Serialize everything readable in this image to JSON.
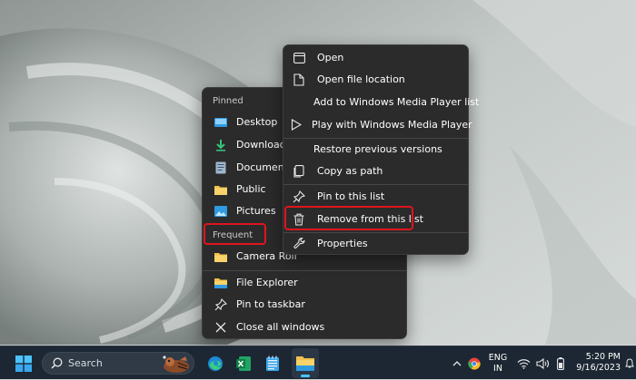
{
  "jumplist": {
    "pinned_header": "Pinned",
    "pinned_items": [
      {
        "label": "Desktop",
        "icon": "desktop-folder-icon"
      },
      {
        "label": "Downloads",
        "icon": "downloads-folder-icon"
      },
      {
        "label": "Documents",
        "icon": "documents-folder-icon"
      },
      {
        "label": "Public",
        "icon": "folder-icon"
      },
      {
        "label": "Pictures",
        "icon": "pictures-folder-icon"
      }
    ],
    "frequent_header": "Frequent",
    "frequent_items": [
      {
        "label": "Camera Roll",
        "icon": "folder-icon"
      }
    ],
    "actions": [
      {
        "label": "File Explorer",
        "icon": "file-explorer-icon"
      },
      {
        "label": "Pin to taskbar",
        "icon": "pin-icon"
      },
      {
        "label": "Close all windows",
        "icon": "close-icon"
      }
    ]
  },
  "context_menu": {
    "items": [
      {
        "label": "Open",
        "icon": "window-icon"
      },
      {
        "label": "Open file location",
        "icon": "file-location-icon"
      },
      {
        "label": "Add to Windows Media Player list",
        "icon": ""
      },
      {
        "label": "Play with Windows Media Player",
        "icon": "play-icon"
      },
      {
        "label": "Restore previous versions",
        "icon": ""
      },
      {
        "label": "Copy as path",
        "icon": "copy-path-icon"
      },
      {
        "label": "Pin to this list",
        "icon": "pin-icon"
      },
      {
        "label": "Remove from this list",
        "icon": "trash-icon"
      },
      {
        "label": "Properties",
        "icon": "wrench-icon"
      }
    ]
  },
  "taskbar": {
    "search_placeholder": "Search",
    "language_line1": "ENG",
    "language_line2": "IN",
    "time": "5:20 PM",
    "date": "9/16/2023"
  },
  "colors": {
    "highlight": "#e0141e",
    "menu_bg": "#2b2b2b",
    "taskbar_bg": "#1c2733",
    "accent": "#0a84d8"
  }
}
